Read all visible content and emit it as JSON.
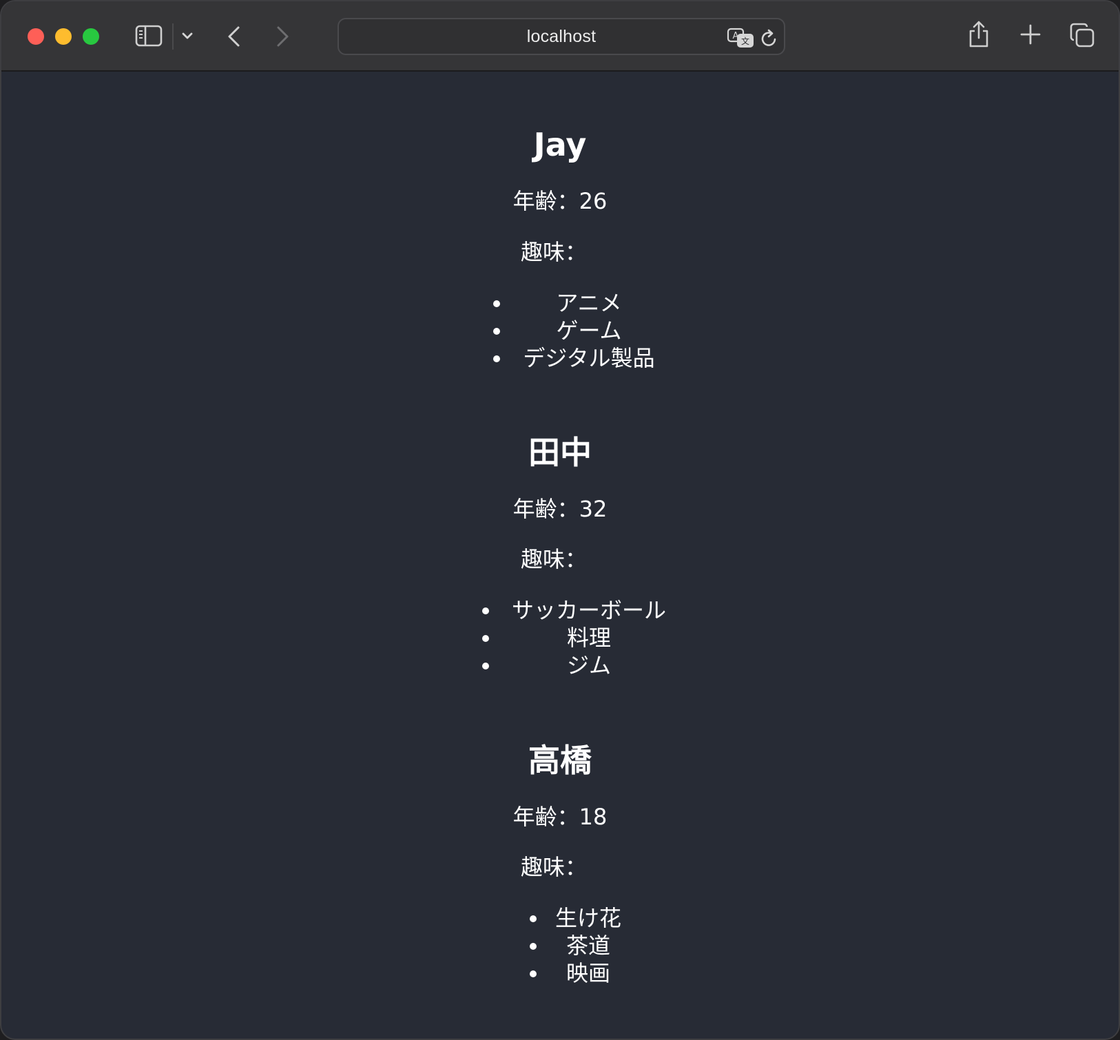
{
  "browser": {
    "url": "localhost"
  },
  "people": [
    {
      "name": "Jay",
      "age_label": "年齢：",
      "age": "26",
      "hobbies_label": "趣味：",
      "hobbies": [
        "アニメ",
        "ゲーム",
        "デジタル製品"
      ]
    },
    {
      "name": "田中",
      "age_label": "年齢：",
      "age": "32",
      "hobbies_label": "趣味：",
      "hobbies": [
        "サッカーボール",
        "料理",
        "ジム"
      ]
    },
    {
      "name": "高橋",
      "age_label": "年齢：",
      "age": "18",
      "hobbies_label": "趣味：",
      "hobbies": [
        "生け花",
        "茶道",
        "映画"
      ]
    }
  ],
  "colors": {
    "page_background": "#272b35",
    "toolbar_background": "#353537",
    "text": "#ffffff",
    "close": "#fe5f57",
    "minimize": "#febc2e",
    "maximize": "#28c840"
  },
  "icons": [
    "sidebar-icon",
    "chevron-down-icon",
    "back-icon",
    "forward-icon",
    "translate-icon",
    "reload-icon",
    "share-icon",
    "new-tab-icon",
    "tab-overview-icon"
  ]
}
